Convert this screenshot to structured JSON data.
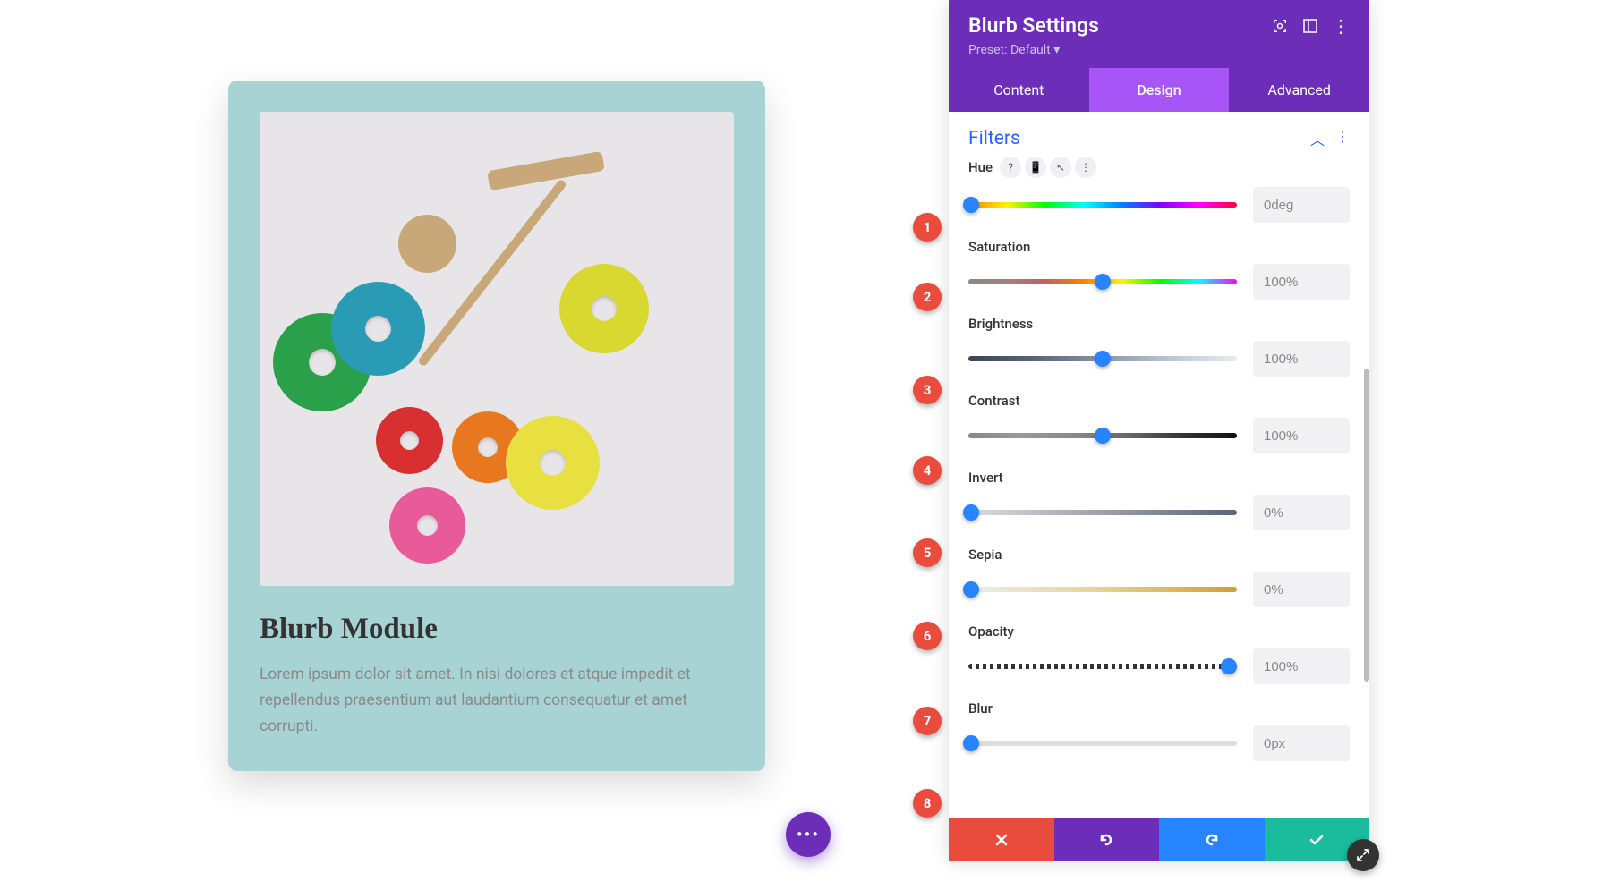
{
  "preview": {
    "title": "Blurb Module",
    "text": "Lorem ipsum dolor sit amet. In nisi dolores et atque impedit et repellendus praesentium aut laudantium consequatur et amet corrupti."
  },
  "panel": {
    "title": "Blurb Settings",
    "preset": "Preset: Default ▾",
    "tabs": {
      "content": "Content",
      "design": "Design",
      "advanced": "Advanced"
    },
    "section": "Filters"
  },
  "hints": {
    "help": "?",
    "device": "📱",
    "cursor": "↖",
    "more": "⋮"
  },
  "filters": [
    {
      "label": "Hue",
      "value": "0deg",
      "pos": 1,
      "track": "linear-gradient(90deg,#ff8000,#fff200,#00ff00,#00ffff,#0080ff,#8000ff,#ff00ff,#ff0040)"
    },
    {
      "label": "Saturation",
      "value": "100%",
      "pos": 50,
      "track": "linear-gradient(90deg,#888,#a08080,#c06060,#ff8000,#fff200,#00ff00,#00ffff,#ff00ff)"
    },
    {
      "label": "Brightness",
      "value": "100%",
      "pos": 50,
      "track": "linear-gradient(90deg,#3a4556,#5a6576,#8a95a6,#bac5d6,#e8ecf0)"
    },
    {
      "label": "Contrast",
      "value": "100%",
      "pos": 50,
      "track": "linear-gradient(90deg,#888,#999,#888,#666,#333,#111)"
    },
    {
      "label": "Invert",
      "value": "0%",
      "pos": 1,
      "track": "linear-gradient(90deg,#ddd,#5a6576)"
    },
    {
      "label": "Sepia",
      "value": "0%",
      "pos": 1,
      "track": "linear-gradient(90deg,#eee,#e8d090,#d0a030)"
    },
    {
      "label": "Opacity",
      "value": "100%",
      "pos": 97,
      "track": "repeating-linear-gradient(90deg,#333 0,#333 4px,transparent 4px,transparent 8px)"
    },
    {
      "label": "Blur",
      "value": "0px",
      "pos": 1,
      "track": "linear-gradient(90deg,#ddd,#ddd)"
    }
  ],
  "annotations": [
    "1",
    "2",
    "3",
    "4",
    "5",
    "6",
    "7",
    "8"
  ]
}
